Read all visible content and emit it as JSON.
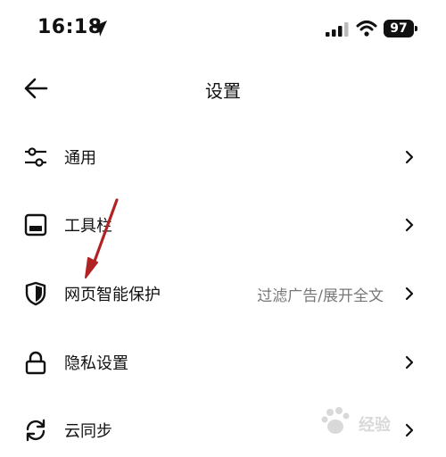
{
  "status_bar": {
    "time": "16:18",
    "battery": "97"
  },
  "header": {
    "title": "设置"
  },
  "settings": [
    {
      "label": "通用",
      "value": ""
    },
    {
      "label": "工具栏",
      "value": ""
    },
    {
      "label": "网页智能保护",
      "value": "过滤广告/展开全文"
    },
    {
      "label": "隐私设置",
      "value": ""
    },
    {
      "label": "云同步",
      "value": ""
    }
  ],
  "colors": {
    "annotation_arrow": "#b22222",
    "text": "#111111",
    "secondary_text": "#777777"
  },
  "watermark": {
    "text": "经验"
  }
}
